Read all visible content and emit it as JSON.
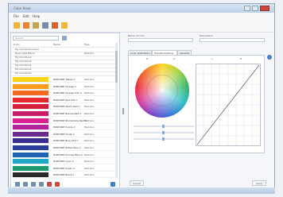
{
  "window": {
    "title": "Color Book"
  },
  "menu": {
    "items": [
      "File",
      "Edit",
      "Help"
    ]
  },
  "toolbar": {
    "buttons": [
      {
        "icon": "new-icon",
        "color": "#f0b63a"
      },
      {
        "icon": "orange-icon",
        "color": "#f07f2a"
      },
      {
        "icon": "open-icon",
        "color": "#c7a24a"
      },
      {
        "icon": "delete-icon",
        "color": "#7a8fa6"
      },
      {
        "icon": "palette-icon",
        "color": "#d2622f"
      },
      {
        "icon": "export-icon",
        "color": "#f0b63a"
      }
    ]
  },
  "left_panel": {
    "search_placeholder": "Search",
    "headers": [
      "Color",
      "Name",
      "Type"
    ],
    "group_rows": [
      {
        "name": "My Colorbook name",
        "type": ""
      },
      {
        "name": "New Light Blend",
        "type": "Pantone"
      },
      {
        "name": "My Colorbook",
        "type": ""
      },
      {
        "name": "My Colorbook",
        "type": ""
      },
      {
        "name": "My Colorbook",
        "type": ""
      },
      {
        "name": "My Colorbook",
        "type": ""
      },
      {
        "name": "My Colorbook",
        "type": ""
      }
    ],
    "color_rows": [
      {
        "color": "#ffd21a",
        "name": "PANTONE Yellow C",
        "type": "Pantone"
      },
      {
        "color": "#ff9b1a",
        "name": "PANTONE Orange C",
        "type": "Pantone"
      },
      {
        "color": "#f46a1f",
        "name": "PANTONE Orange 021 C",
        "type": "Pantone"
      },
      {
        "color": "#e8292d",
        "name": "PANTONE Red 032 C",
        "type": "Pantone"
      },
      {
        "color": "#d31f3a",
        "name": "PANTONE Warm Red C",
        "type": "Pantone"
      },
      {
        "color": "#c91f6a",
        "name": "PANTONE Rubine Red C",
        "type": "Pantone"
      },
      {
        "color": "#d8238e",
        "name": "PANTONE Rhodamine Red C",
        "type": "Pantone"
      },
      {
        "color": "#b2239a",
        "name": "PANTONE Purple C",
        "type": "Pantone"
      },
      {
        "color": "#6a2c91",
        "name": "PANTONE Violet C",
        "type": "Pantone"
      },
      {
        "color": "#3a2f8f",
        "name": "PANTONE Blue 072 C",
        "type": "Pantone"
      },
      {
        "color": "#2a3f9c",
        "name": "PANTONE Reflex Blue C",
        "type": "Pantone"
      },
      {
        "color": "#1f63b5",
        "name": "PANTONE Process Blue C",
        "type": "Pantone"
      },
      {
        "color": "#20a7c8",
        "name": "PANTONE Cyan C",
        "type": "Pantone"
      },
      {
        "color": "#1b9b6d",
        "name": "PANTONE Green C",
        "type": "Pantone"
      },
      {
        "color": "#2a2a2a",
        "name": "PANTONE Black C",
        "type": "Pantone"
      }
    ],
    "bottom_buttons": [
      {
        "icon": "add-icon",
        "color": "#6f8fb3"
      },
      {
        "icon": "edit-icon",
        "color": "#6f8fb3"
      },
      {
        "icon": "grid-icon",
        "color": "#6f8fb3"
      },
      {
        "icon": "copy-icon",
        "color": "#6f8fb3"
      },
      {
        "icon": "import-icon",
        "color": "#c94a3d"
      },
      {
        "icon": "export-icon",
        "color": "#c94a3d"
      },
      {
        "icon": "info-icon",
        "color": "#3f7fd0"
      }
    ]
  },
  "right_panel": {
    "name_label": "Name of color",
    "desc_label": "Description",
    "tabs": [
      "Color Definitions",
      "Transformations",
      "Variants"
    ],
    "wheel_cols": [
      "H",
      "S"
    ],
    "curve_cols": [
      "L",
      "R"
    ],
    "buttons": {
      "left": "Cancel",
      "right": "Apply"
    }
  }
}
